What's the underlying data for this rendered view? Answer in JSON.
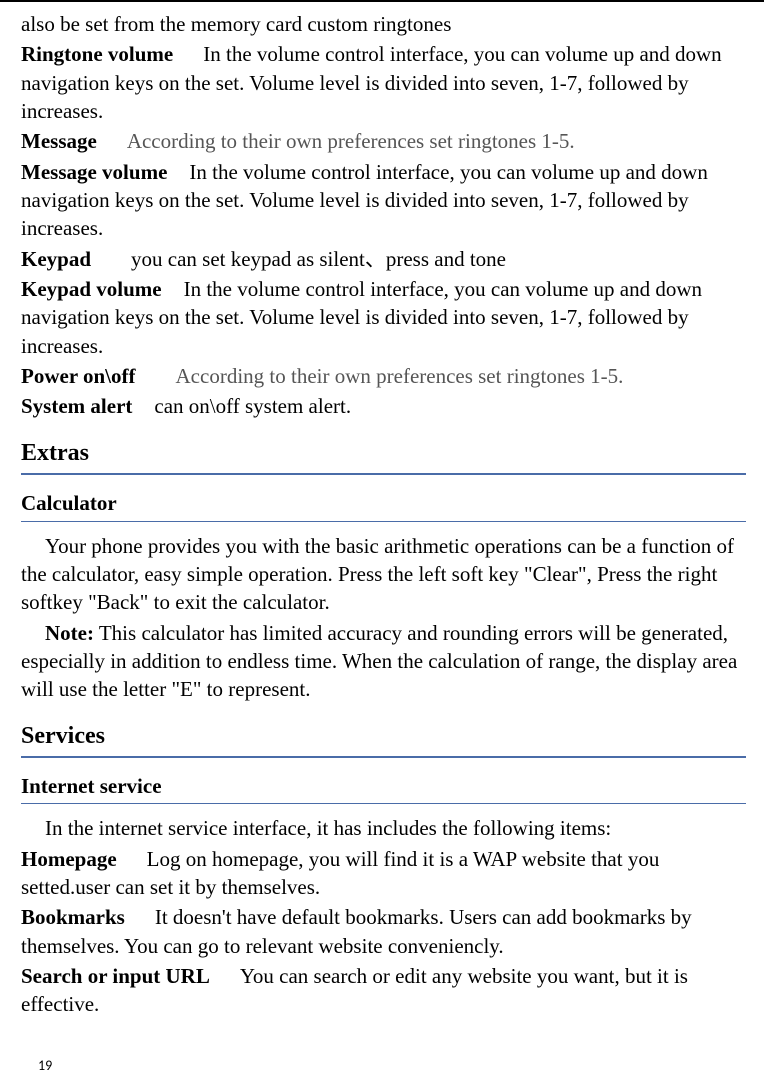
{
  "intro_line": "also be set from the memory card custom ringtones",
  "items": {
    "ringtone_volume": {
      "label": "Ringtone volume",
      "text": "In the volume control interface, you can volume up and down navigation keys on the set. Volume level is divided into seven, 1-7, followed by increases."
    },
    "message": {
      "label": "Message",
      "text": "According to their own preferences set ringtones 1-5."
    },
    "message_volume": {
      "label": "Message volume",
      "text": "In the volume control interface, you can volume up and down navigation keys on the set. Volume level is divided into seven, 1-7, followed by increases."
    },
    "keypad": {
      "label": "Keypad",
      "text": "you can set keypad as silent、press and tone"
    },
    "keypad_volume": {
      "label": "Keypad volume",
      "text": "In the volume control interface, you can volume up and down navigation keys on the set. Volume level is divided into seven, 1-7, followed by increases."
    },
    "power": {
      "label": "Power on\\off",
      "text": "According to their own preferences set ringtones 1-5."
    },
    "system_alert": {
      "label": "System alert",
      "text": "can on\\off system alert."
    }
  },
  "extras": {
    "title": "Extras",
    "calculator": {
      "title": "Calculator",
      "p1": "Your phone provides you with the basic arithmetic operations can be a function of the calculator, easy simple operation. Press the left soft key \"Clear\", Press the right softkey \"Back\" to exit the calculator.",
      "note_label": "Note:",
      "note_text": " This calculator has limited accuracy and rounding errors will be generated, especially in addition to endless time. When the calculation of range, the display area will use the letter \"E\" to represent."
    }
  },
  "services": {
    "title": "Services",
    "internet": {
      "title": "Internet service",
      "intro": "In the internet service interface, it has includes the following items:",
      "homepage": {
        "label": "Homepage",
        "text": "Log on homepage, you will find it is a WAP website that you setted.user can set it by themselves."
      },
      "bookmarks": {
        "label": "Bookmarks",
        "text": "It doesn't have default bookmarks. Users can add bookmarks by themselves. You can go to relevant website conveniencly."
      },
      "search": {
        "label": "Search or input URL",
        "text": "You can search or edit any website you want, but it is effective."
      }
    }
  },
  "page_number": "19"
}
